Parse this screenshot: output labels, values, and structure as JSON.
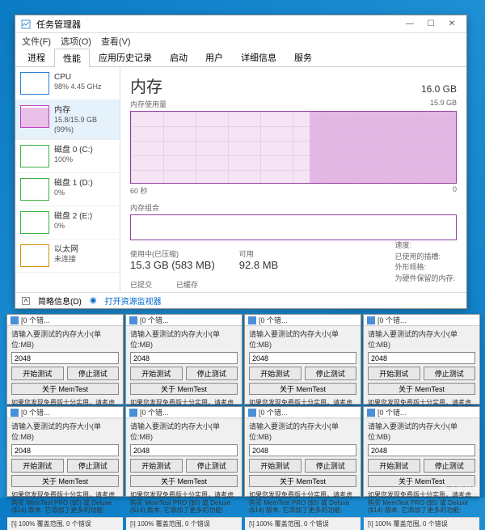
{
  "taskmgr": {
    "title": "任务管理器",
    "menu": [
      "文件(F)",
      "选项(O)",
      "查看(V)"
    ],
    "tabs": [
      "进程",
      "性能",
      "应用历史记录",
      "启动",
      "用户",
      "详细信息",
      "服务"
    ],
    "active_tab": 1,
    "side": [
      {
        "name": "CPU",
        "sub": "98%  4.45 GHz"
      },
      {
        "name": "内存",
        "sub": "15.8/15.9 GB (99%)"
      },
      {
        "name": "磁盘 0 (C:)",
        "sub": "100%"
      },
      {
        "name": "磁盘 1 (D:)",
        "sub": "0%"
      },
      {
        "name": "磁盘 2 (E:)",
        "sub": "0%"
      },
      {
        "name": "以太网",
        "sub": "未连接"
      }
    ],
    "main": {
      "heading": "内存",
      "total": "16.0 GB",
      "usage_label": "内存使用量",
      "usage_max": "15.9 GB",
      "axis_left": "60 秒",
      "axis_right": "0",
      "comp_label": "内存组合",
      "stats": [
        {
          "label": "使用中(已压缩)",
          "value": "15.3 GB (583 MB)"
        },
        {
          "label": "可用",
          "value": "92.8 MB"
        }
      ],
      "stats2": [
        {
          "label": "已提交",
          "value": ""
        },
        {
          "label": "已缓存",
          "value": ""
        }
      ],
      "meta": [
        "速度:",
        "已使用的插槽:",
        "外形规格:",
        "为硬件保留的内存:"
      ]
    },
    "footer": {
      "fewer": "简略信息(D)",
      "link": "打开资源监视器"
    }
  },
  "memtest": {
    "title": "[0 个错...",
    "label": "请输入要测试的内存大小(单位:MB)",
    "value": "2048",
    "btn_start": "开始测试",
    "btn_stop": "停止测试",
    "btn_about": "关于 MemTest",
    "desc": "如果您发现免费版十分实用，请考虑购买 MemTest PRO ($5) 或 Deluxe ($14) 版本. 它添加了更多的功能:",
    "status": "[\\]  100% 覆盖范围, 0 个错误"
  },
  "watermark": "电子发烧友"
}
